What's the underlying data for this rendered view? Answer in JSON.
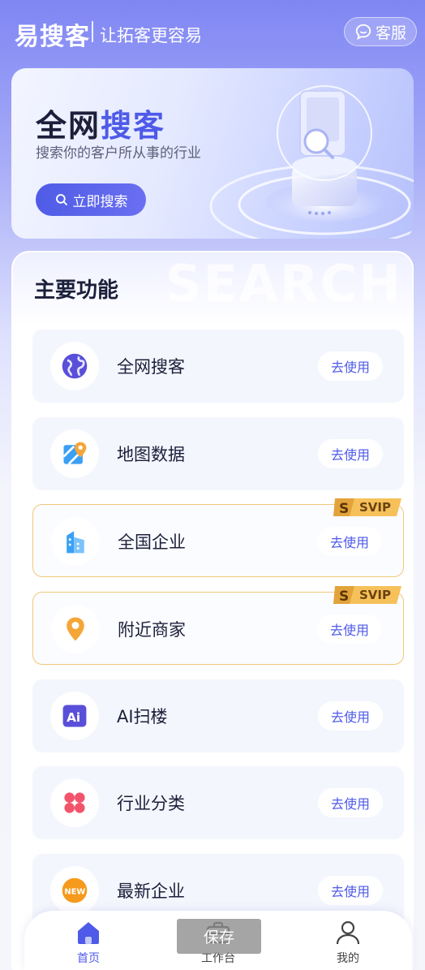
{
  "header": {
    "logo": "易搜客",
    "slogan": "让拓客更容易",
    "service_label": "客服"
  },
  "banner": {
    "title_part1": "全网",
    "title_part2": "搜客",
    "subtitle": "搜索你的客户所从事的行业",
    "button_label": "立即搜索"
  },
  "main": {
    "watermark": "SEARCH",
    "section_title": "主要功能",
    "items": [
      {
        "label": "全网搜客",
        "button": "去使用",
        "icon": "globe-icon",
        "svip": false
      },
      {
        "label": "地图数据",
        "button": "去使用",
        "icon": "map-pin-icon",
        "svip": false
      },
      {
        "label": "全国企业",
        "button": "去使用",
        "icon": "building-icon",
        "svip": true
      },
      {
        "label": "附近商家",
        "button": "去使用",
        "icon": "location-pin-icon",
        "svip": true
      },
      {
        "label": "AI扫楼",
        "button": "去使用",
        "icon": "ai-icon",
        "svip": false
      },
      {
        "label": "行业分类",
        "button": "去使用",
        "icon": "category-icon",
        "svip": false
      },
      {
        "label": "最新企业",
        "button": "去使用",
        "icon": "new-badge-icon",
        "svip": false
      }
    ],
    "svip_text": "SVIP"
  },
  "nav": {
    "home": "首页",
    "workbench": "工作台",
    "mine": "我的"
  },
  "overlay": {
    "save": "保存"
  },
  "colors": {
    "accent": "#4e5ae8",
    "svip_border": "#f1c77a",
    "svip_badge": "#f6c15a"
  }
}
